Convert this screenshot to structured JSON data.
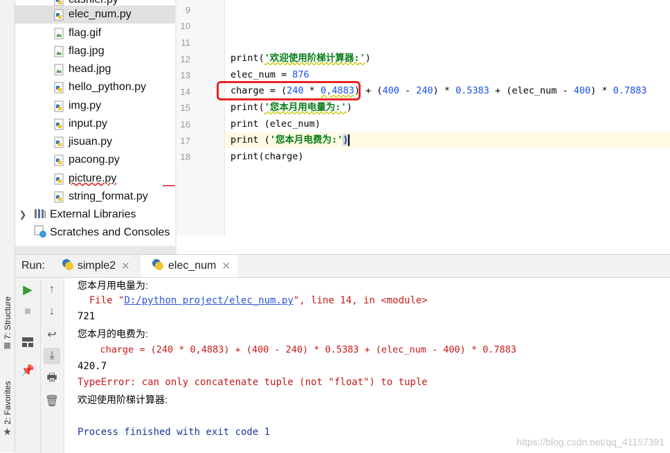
{
  "left_strip": {
    "structure_label": "7: Structure",
    "favorites_label": "2: Favorites"
  },
  "project_tree": {
    "items": [
      {
        "label": "cashier.py",
        "type": "py"
      },
      {
        "label": "elec_num.py",
        "type": "py",
        "selected": true
      },
      {
        "label": "flag.gif",
        "type": "image"
      },
      {
        "label": "flag.jpg",
        "type": "image"
      },
      {
        "label": "head.jpg",
        "type": "image"
      },
      {
        "label": "hello_python.py",
        "type": "py"
      },
      {
        "label": "img.py",
        "type": "py"
      },
      {
        "label": "input.py",
        "type": "py"
      },
      {
        "label": "jisuan.py",
        "type": "py"
      },
      {
        "label": "pacong.py",
        "type": "py"
      },
      {
        "label": "picture.py",
        "type": "py"
      },
      {
        "label": "string_format.py",
        "type": "py"
      }
    ],
    "external_libraries": "External Libraries",
    "scratches": "Scratches and Consoles"
  },
  "editor": {
    "line_numbers": [
      "9",
      "10",
      "11",
      "12",
      "13",
      "14",
      "15",
      "16",
      "17",
      "18"
    ]
  },
  "code": {
    "l12_kw": "print(",
    "l12_str": "'欢迎使用阶梯计算器:'",
    "l12_end": ")",
    "l13_a": "elec_num = ",
    "l13_num": "876",
    "l14_a": "charge = (",
    "l14_n1": "240",
    "l14_b": " * ",
    "l14_n2": "0,4883",
    "l14_c": ") + (",
    "l14_n3": "400",
    "l14_d": " - ",
    "l14_n4": "240",
    "l14_e": ") * ",
    "l14_n5": "0.5383",
    "l14_f": " + (elec_num - ",
    "l14_n6": "400",
    "l14_g": ") * ",
    "l14_n7": "0.7883",
    "l15_kw": "print(",
    "l15_str": "'您本月用电量为:'",
    "l15_end": ")",
    "l16": "print (elec_num)",
    "l17_kw": "print (",
    "l17_str": "'您本月电费为:'",
    "l17_end": ")",
    "l18": "print(charge)"
  },
  "run_panel": {
    "run_label": "Run:",
    "tabs": [
      {
        "label": "simple2"
      },
      {
        "label": "elec_num"
      }
    ],
    "output": {
      "o1": "您本月用电量为:",
      "o2_a": "  File \"",
      "o2_link": "D:/python project/elec_num.py",
      "o2_b": "\", line 14, in <module>",
      "o3": "721",
      "o4": "您本月的电费为:",
      "o5": "    charge = (240 * 0,4883) + (400 - 240) * 0.5383 + (elec_num - 400) * 0.7883",
      "o6": "420.7",
      "o7": "TypeError: can only concatenate tuple (not \"float\") to tuple",
      "o8": "欢迎使用阶梯计算器:",
      "o9": "Process finished with exit code 1"
    },
    "watermark": "https://blog.csdn.net/qq_41157391"
  },
  "colors": {
    "string": "#067d17",
    "number": "#1750eb",
    "error": "#c41a16",
    "highlight_box": "#e52424",
    "run_green": "#3c9a3c"
  }
}
